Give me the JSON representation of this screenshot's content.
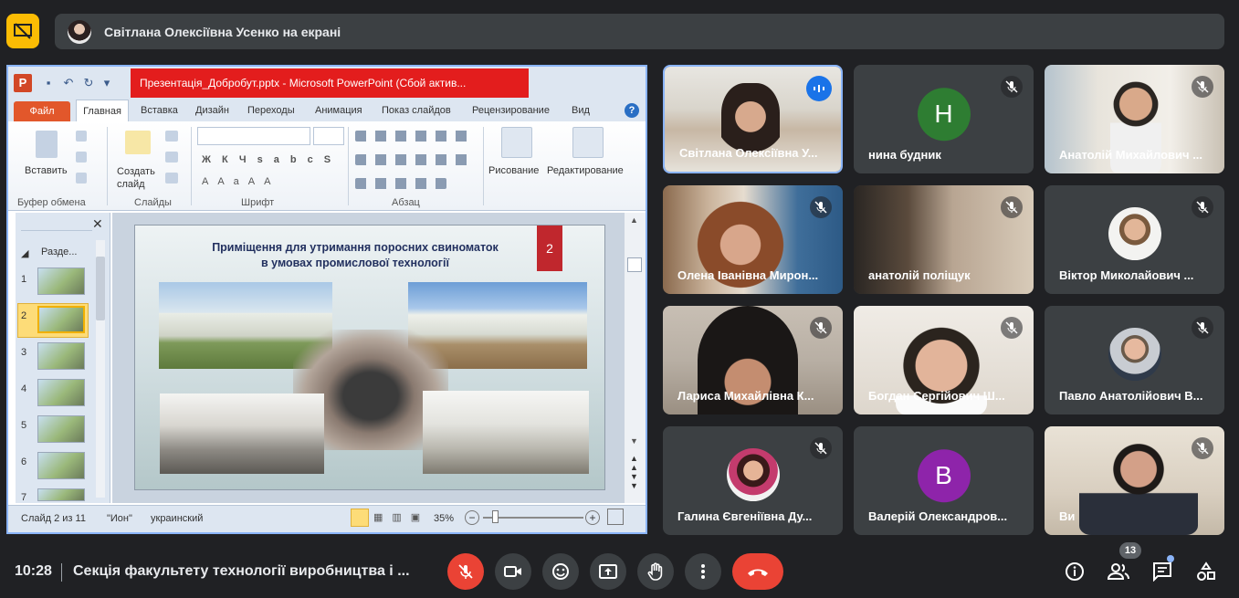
{
  "banner": {
    "presenter_text": "Світлана Олексіївна Усенко на екрані"
  },
  "powerpoint": {
    "window_title": "Презентація_Добробут.pptx - Microsoft PowerPoint (Сбой актив...",
    "tabs": [
      "Файл",
      "Главная",
      "Вставка",
      "Дизайн",
      "Переходы",
      "Анимация",
      "Показ слайдов",
      "Рецензирование",
      "Вид"
    ],
    "ribbon": {
      "paste": "Вставить",
      "new_slide": "Создать слайд",
      "drawing": "Рисование",
      "editing": "Редактирование",
      "groups": [
        "Буфер обмена",
        "Слайды",
        "Шрифт",
        "Абзац"
      ]
    },
    "outline_section": "Разде...",
    "slide_numbers": [
      "1",
      "2",
      "3",
      "4",
      "5",
      "6",
      "7"
    ],
    "slide": {
      "title_line1": "Приміщення для утримання поросних свиноматок",
      "title_line2": "в умовах промислової технології",
      "number": "2"
    },
    "status": {
      "slide_counter": "Слайд 2 из 11",
      "theme": "\"Ион\"",
      "language": "украинский",
      "zoom": "35%"
    }
  },
  "participants": [
    {
      "name": "Світлана Олексіївна У...",
      "type": "video",
      "speaking": true
    },
    {
      "name": "нина будник",
      "type": "initial",
      "initial": "Н",
      "color": "#2e7d32",
      "muted": true
    },
    {
      "name": "Анатолій Михайлович ...",
      "type": "video",
      "muted": true
    },
    {
      "name": "Олена Іванівна Мирон...",
      "type": "video",
      "muted": true
    },
    {
      "name": "анатолій поліщук",
      "type": "video",
      "muted": true
    },
    {
      "name": "Віктор Миколайович ...",
      "type": "avatar",
      "muted": true
    },
    {
      "name": "Лариса Михайлівна К...",
      "type": "video",
      "muted": true
    },
    {
      "name": "Богдан Сергійович Ш...",
      "type": "video",
      "muted": true
    },
    {
      "name": "Павло Анатолійович В...",
      "type": "avatar",
      "muted": true
    },
    {
      "name": "Галина Євгеніївна Ду...",
      "type": "avatar",
      "muted": true
    },
    {
      "name": "Валерій Олександров...",
      "type": "initial",
      "initial": "В",
      "color": "#8e24aa",
      "muted": true
    },
    {
      "name": "Ви",
      "type": "video",
      "muted": true
    }
  ],
  "bottom": {
    "time": "10:28",
    "meeting_title": "Секція факультету технології виробництва і ...",
    "people_count": "13"
  }
}
